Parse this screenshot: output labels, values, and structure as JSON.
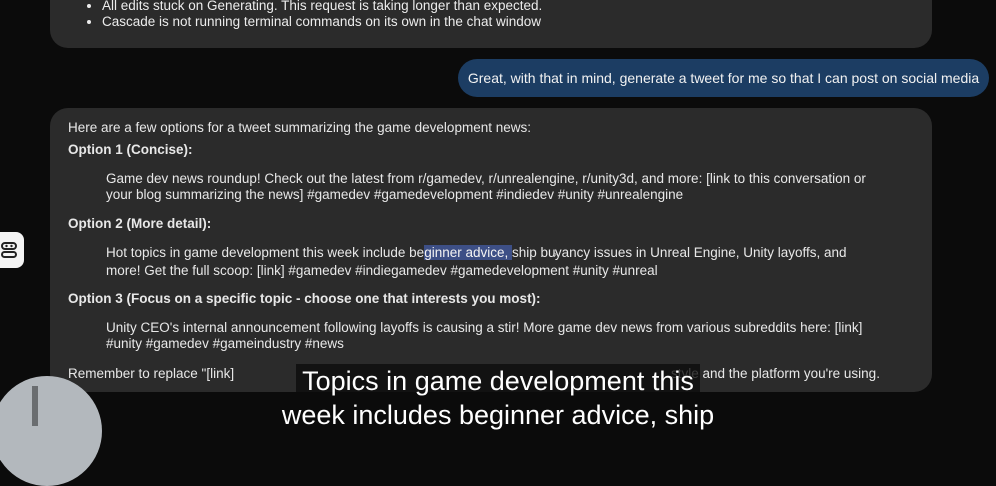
{
  "previous_message": {
    "items": [
      "All edits stuck on Generating. This request is taking longer than expected.",
      "Cascade is not running terminal commands on its own in the chat window"
    ]
  },
  "user_message": {
    "text": "Great, with that in mind, generate a tweet for me so that I can post on social media"
  },
  "assistant_message": {
    "intro": "Here are a few options for a tweet summarizing the game development news:",
    "option1": {
      "heading": "Option 1 (Concise):",
      "line1": "Game dev news roundup! Check out the latest from r/gamedev, r/unrealengine, r/unity3d, and more: [link to this conversation or",
      "line2": "your blog summarizing the news] #gamedev #gamedevelopment #indiedev #unity #unrealengine"
    },
    "option2": {
      "heading": "Option 2 (More detail):",
      "line1_before": "Hot topics in game development this week include be",
      "line1_highlight": "ginner advice, ",
      "line1_mid": "ship bu",
      "line1_after": "yancy issues in Unreal Engine, Unity layoffs, and",
      "line2": "more! Get the full scoop: [link] #gamedev #indiegamedev #gamedevelopment #unity #unreal"
    },
    "option3": {
      "heading": "Option 3 (Focus on a specific topic - choose one that interests you most):",
      "line1": "Unity CEO's internal announcement following layoffs is causing a stir! More game dev news from various subreddits here: [link]",
      "line2": "#unity #gamedev #gameindustry #news"
    },
    "footer_start": "Remember to replace \"[link]",
    "footer_end": "style and the platform you're using."
  },
  "caption": {
    "line1": "Topics in game development this",
    "line2": "week includes beginner advice, ship"
  },
  "icons": {
    "side": "robot-icon",
    "cursor": "text-cursor-icon"
  },
  "colors": {
    "page_background": "#0b0b0b",
    "bubble": "#2b2b2b",
    "user_bubble": "#1c3d63",
    "highlight": "#3d4f86"
  }
}
